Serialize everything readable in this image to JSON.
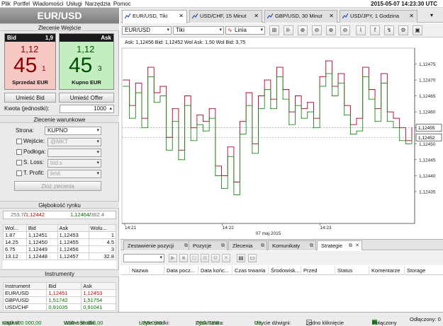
{
  "menu": {
    "items": [
      "Plik",
      "Portfel",
      "Wiadomości",
      "Usługi",
      "Narzędzia",
      "Pomoc"
    ],
    "clock": "2015-05-07 14:23:30 UTC"
  },
  "pair": "EUR/USD",
  "quick_order": {
    "title": "Zlecenie Wejście",
    "bid_label": "Bid",
    "bid_spread": "1,9",
    "ask_label": "Ask",
    "bid_small": "1,12",
    "bid_big": "45",
    "bid_pip": "1",
    "sell_label": "Sprzedaż EUR",
    "ask_small": "1,12",
    "ask_big": "45",
    "ask_pip": "3",
    "buy_label": "Kupno EUR",
    "place_bid": "Umieść Bid",
    "place_offer": "Umieść Offer",
    "amount_label": "Kwota (jednostki):",
    "amount_value": "1000"
  },
  "conditional": {
    "title": "Zlecenie warunkowe",
    "side_label": "Strona:",
    "side_value": "KUPNO",
    "entry_label": "Wejście:",
    "entry_value": "@MKT",
    "bid_label": "Podłoga:",
    "sl_label": "S. Loss:",
    "sl_value": "bid:s",
    "tp_label": "T. Profit:",
    "tp_value": "limit",
    "submit": "Złóż zlecenia"
  },
  "depth": {
    "title": "Głębokość rynku",
    "summary_left_a": "253.7",
    "summary_left_b": "1,12442",
    "summary_right_a": "1,12464",
    "summary_right_b": "362.4",
    "headers": [
      "Wol...",
      "Bid",
      "Ask",
      "Wolu..."
    ],
    "rows": [
      [
        "1.87",
        "1,12451",
        "1,12453",
        "1"
      ],
      [
        "14.25",
        "1,12450",
        "1,12455",
        "4.5"
      ],
      [
        "6.75",
        "1,12449",
        "1,12456",
        "3"
      ],
      [
        "13.12",
        "1,12448",
        "1,12457",
        "32.8"
      ]
    ]
  },
  "instruments": {
    "title": "Instrumenty",
    "headers": [
      "Instrument",
      "Bid",
      "Ask"
    ],
    "rows": [
      [
        "EUR/USD",
        "1,12451",
        "1,12453"
      ],
      [
        "GBP/USD",
        "1,51742",
        "1,51754"
      ],
      [
        "USD/CHF",
        "0,91035",
        "0,91041"
      ]
    ]
  },
  "chart_tabs": [
    {
      "label": "EUR/USD, Tiki"
    },
    {
      "label": "USD/CHF, 15 Minut"
    },
    {
      "label": "GBP/USD, 30 Minut"
    },
    {
      "label": "USD/JPY, 1 Godzina"
    }
  ],
  "chart_toolbar": {
    "instrument": "EUR/USD",
    "period": "Tiki",
    "style": "Linia"
  },
  "chart_info": "Ask: 1,12456  Bid: 1,12452  Wol Ask: 1,50  Wol Bid: 3,75",
  "chart_data": {
    "type": "line",
    "xlabel": "",
    "ylabel": "",
    "x_ticks": [
      "14:21",
      "14:22",
      "14:23"
    ],
    "date_label": "07 maj 2015",
    "ylim": [
      1.12425,
      1.1248
    ],
    "y_ticks": [
      "1,12475",
      "1,12470",
      "1,12465",
      "1,12460",
      "1,12455",
      "1,12450",
      "1,12445",
      "1,12440",
      "1,12435"
    ],
    "highlight_ask": "1,12455",
    "highlight_bid": "1,12452",
    "series": [
      {
        "color": "#b00020",
        "values": [
          1.1247,
          1.12462,
          1.12469,
          1.12458,
          1.12474,
          1.12466,
          1.12468,
          1.12452,
          1.12461,
          1.12448,
          1.12465,
          1.12455,
          1.12459,
          1.12457,
          1.12461,
          1.12443,
          1.1244,
          1.12449,
          1.12438,
          1.12457,
          1.12466,
          1.1245,
          1.12465,
          1.1247,
          1.12464,
          1.12474,
          1.12467,
          1.1246,
          1.12465,
          1.12461,
          1.12463,
          1.12458,
          1.12471,
          1.12476,
          1.12468,
          1.12472,
          1.12462,
          1.12456,
          1.12458,
          1.12474,
          1.12467,
          1.12461,
          1.12472,
          1.1246,
          1.12458,
          1.12455,
          1.12451,
          1.12455
        ]
      },
      {
        "color": "#1a8a1a",
        "values": [
          1.12468,
          1.12458,
          1.12466,
          1.12455,
          1.12471,
          1.12463,
          1.12465,
          1.12448,
          1.12457,
          1.12445,
          1.12462,
          1.12451,
          1.12456,
          1.12454,
          1.12458,
          1.1244,
          1.12436,
          1.12446,
          1.12434,
          1.12453,
          1.12462,
          1.12447,
          1.12461,
          1.12467,
          1.12461,
          1.12471,
          1.12464,
          1.12456,
          1.12462,
          1.12458,
          1.1246,
          1.12455,
          1.12468,
          1.12472,
          1.12465,
          1.12469,
          1.12459,
          1.12453,
          1.12454,
          1.12471,
          1.12464,
          1.12457,
          1.12469,
          1.12457,
          1.12455,
          1.12451,
          1.1245,
          1.12452
        ]
      }
    ]
  },
  "bottom_tabs": [
    {
      "label": "Zestawienie pozycji"
    },
    {
      "label": "Pozycje"
    },
    {
      "label": "Zlecenia"
    },
    {
      "label": "Komunikaty"
    },
    {
      "label": "Strategie"
    }
  ],
  "strategies": {
    "headers": [
      "Nazwa",
      "Data pocz...",
      "Data końc...",
      "Czas trwania",
      "Środowisk...",
      "Przed",
      "Status",
      "Komentarze",
      "Storage"
    ]
  },
  "status": {
    "capital_label": "Kapitał:",
    "capital_value": "USD 100 000,00",
    "free_label": "Wolne środki:",
    "free_value": "USD 100 000,00",
    "used_label": "Użyte środki:",
    "used_value": "USD 0,00",
    "pl_label": "Zysk/Strata:",
    "pl_value": "USD 0,00",
    "lev_label": "Użycie dźwigni:",
    "lev_value": "0%",
    "oneclick_label": "Jedno kliknięcie",
    "connected": "Połączony",
    "disconnected": "Odłączony: 0"
  }
}
